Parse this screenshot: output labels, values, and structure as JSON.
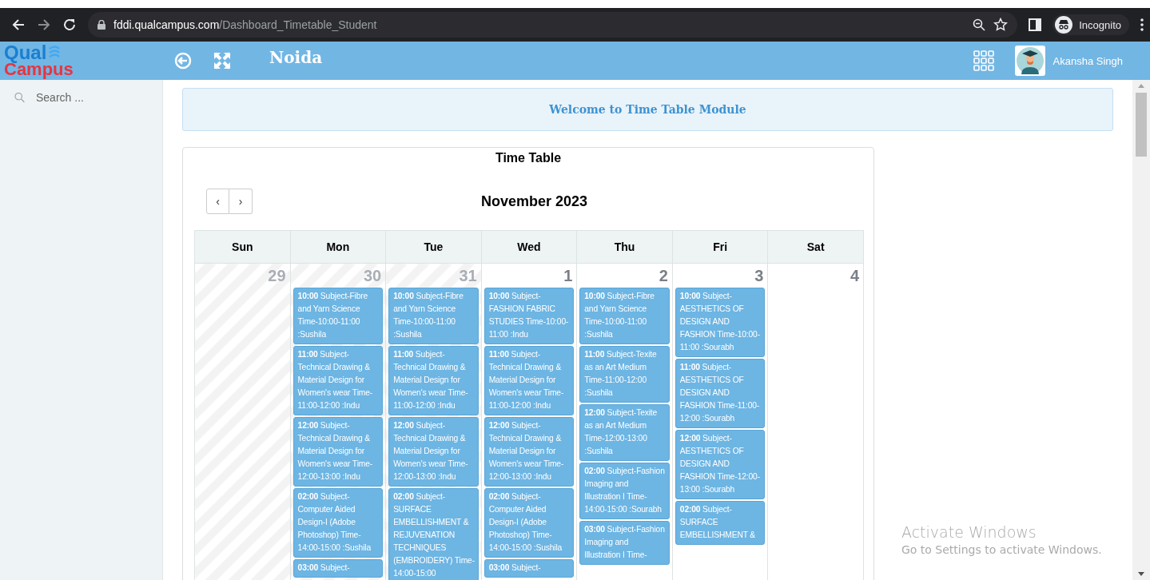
{
  "browser": {
    "url_host": "fddi.qualcampus.com",
    "url_path": "/Dashboard_Timetable_Student",
    "profile_label": "Incognito"
  },
  "header": {
    "logo_top": "Qual",
    "logo_bottom": "Campus",
    "location": "Noida",
    "user_name": "Akansha Singh"
  },
  "sidebar": {
    "search_placeholder": "Search ..."
  },
  "welcome": "Welcome to Time Table Module",
  "timetable": {
    "title": "Time Table",
    "nav": [
      "‹",
      "›"
    ],
    "month_label": "November 2023",
    "weekdays": [
      "Sun",
      "Mon",
      "Tue",
      "Wed",
      "Thu",
      "Fri",
      "Sat"
    ],
    "days": [
      {
        "number": "29",
        "other_month": true
      },
      {
        "number": "30",
        "other_month": true,
        "events": [
          "**10:00** Subject-Fibre and Yarn Science Time-10:00-11:00 :Sushila",
          "**11:00** Subject-Technical Drawing & Material Design for Women's wear Time-11:00-12:00 :Indu",
          "**12:00** Subject-Technical Drawing & Material Design for Women's wear Time-12:00-13:00 :Indu",
          "**02:00** Subject-Computer Aided Design-I (Adobe Photoshop) Time-14:00-15:00 :Sushila",
          "**03:00** Subject-"
        ]
      },
      {
        "number": "31",
        "other_month": true,
        "events": [
          "**10:00** Subject-Fibre and Yarn Science Time-10:00-11:00 :Sushila",
          "**11:00** Subject-Technical Drawing & Material Design for Women's wear Time-11:00-12:00 :Indu",
          "**12:00** Subject-Technical Drawing & Material Design for Women's wear Time-12:00-13:00 :Indu",
          "**02:00** Subject-SURFACE EMBELLISHMENT & REJUVENATION TECHNIQUES (EMBROIDERY) Time-14:00-15:00"
        ]
      },
      {
        "number": "1",
        "other_month": false,
        "events": [
          "**10:00** Subject-FASHION FABRIC STUDIES Time-10:00-11:00 :Indu",
          "**11:00** Subject-Technical Drawing & Material Design for Women's wear Time-11:00-12:00 :Indu",
          "**12:00** Subject-Technical Drawing & Material Design for Women's wear Time-12:00-13:00 :Indu",
          "**02:00** Subject-Computer Aided Design-I (Adobe Photoshop) Time-14:00-15:00 :Sushila",
          "**03:00** Subject-"
        ]
      },
      {
        "number": "2",
        "other_month": false,
        "events": [
          "**10:00** Subject-Fibre and Yarn Science Time-10:00-11:00 :Sushila",
          "**11:00** Subject-Texite as an Art Medium Time-11:00-12:00 :Sushila",
          "**12:00** Subject-Texite as an Art Medium Time-12:00-13:00 :Sushila",
          "**02:00** Subject-Fashion Imaging and Illustration I Time-14:00-15:00 :Sourabh",
          "**03:00** Subject-Fashion Imaging and Illustration I Time-"
        ]
      },
      {
        "number": "3",
        "other_month": false,
        "events": [
          "**10:00** Subject-AESTHETICS OF DESIGN AND FASHION Time-10:00-11:00 :Sourabh",
          "**11:00** Subject-AESTHETICS OF DESIGN AND FASHION Time-11:00-12:00 :Sourabh",
          "**12:00** Subject-AESTHETICS OF DESIGN AND FASHION Time-12:00-13:00 :Sourabh",
          "**02:00** Subject-SURFACE EMBELLISHMENT &"
        ]
      },
      {
        "number": "4",
        "other_month": false
      }
    ]
  },
  "os_notice": {
    "title": "Activate Windows",
    "subtitle": "Go to Settings to activate Windows."
  }
}
